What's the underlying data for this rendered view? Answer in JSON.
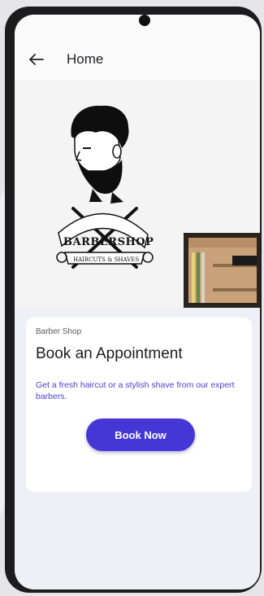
{
  "app_bar": {
    "title": "Home",
    "back_icon": "arrow-left-icon"
  },
  "hero": {
    "logo_text": "BARBERSHOP",
    "logo_tagline": "HAIRCUTS & SHAVES"
  },
  "card": {
    "subtitle": "Barber Shop",
    "title": "Book an Appointment",
    "description": "Get a fresh haircut or a stylish shave from our expert barbers.",
    "button_label": "Book Now"
  },
  "colors": {
    "accent": "#4536d6",
    "description_text": "#4b3fd8",
    "background": "#eef0f6"
  }
}
